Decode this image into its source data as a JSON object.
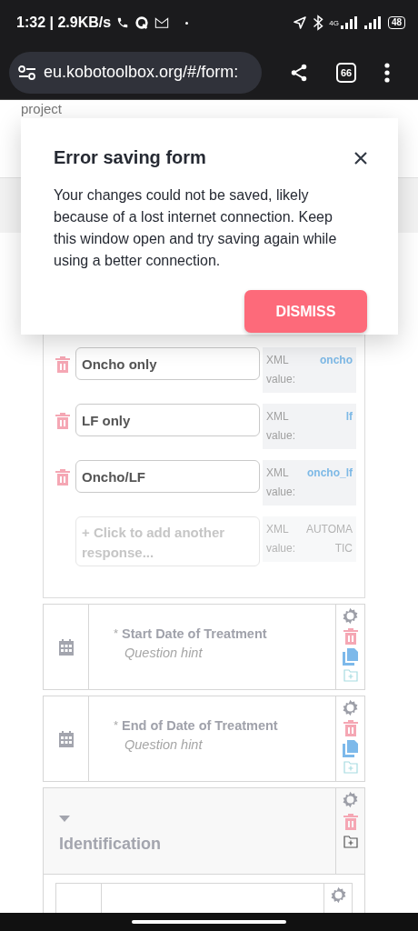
{
  "status_bar": {
    "time": "1:32 | 2.9KB/s",
    "network": "4G",
    "battery": "48"
  },
  "browser": {
    "url": "eu.kobotoolbox.org/#/form:",
    "tab_count": "66"
  },
  "page": {
    "header_text": "project"
  },
  "dialog": {
    "title": "Error saving form",
    "message": "Your changes could not be saved, likely because of a lost internet connection. Keep this window open and try saving again while using a better connection.",
    "button": "DISMISS"
  },
  "choices": [
    {
      "kind": "choice",
      "label": "Oncho only",
      "xml_label": "XML value:",
      "xml_value": "oncho"
    },
    {
      "kind": "choice",
      "label": "LF only",
      "xml_label": "XML value:",
      "xml_value": "lf"
    },
    {
      "kind": "choice",
      "label": "Oncho/LF",
      "xml_label": "XML value:",
      "xml_value": "oncho_lf"
    },
    {
      "kind": "add",
      "placeholder": "+ Click to add another response...",
      "xml_label": "XML value:",
      "xml_value": "AUTOMATIC"
    }
  ],
  "questions": [
    {
      "kind": "date",
      "required_mark": "*",
      "label": "Start Date of Treatment",
      "hint": "Question hint"
    },
    {
      "kind": "date",
      "required_mark": "*",
      "label": "End of Date of Treatment",
      "hint": "Question hint"
    },
    {
      "kind": "group",
      "label": "Identification",
      "expanded": true
    }
  ]
}
